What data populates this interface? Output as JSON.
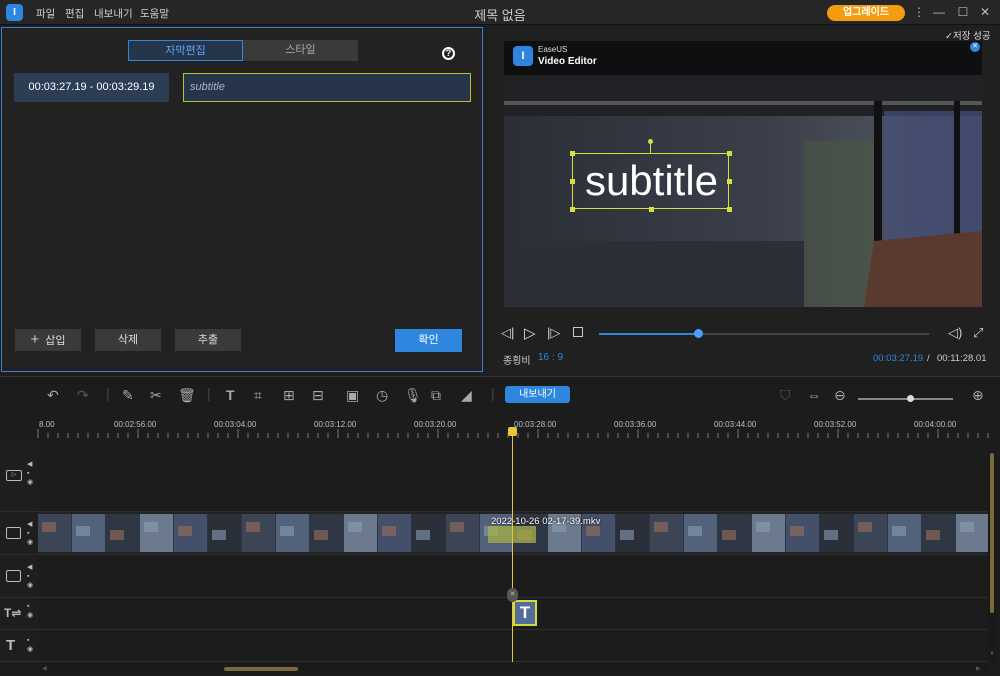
{
  "app": {
    "title": "제목 없음",
    "menu": [
      "파일",
      "편집",
      "내보내기",
      "도움말"
    ],
    "upgrade_label": "업그레이드",
    "logo_glyph": "I"
  },
  "subtitle_editor": {
    "tabs": [
      "자막편집",
      "스타일"
    ],
    "active_tab": "자막편집",
    "entry": {
      "time_range": "00:03:27.19 - 00:03:29.19",
      "text_placeholder": "subtitle"
    },
    "buttons": {
      "insert": "삽입",
      "delete": "삭제",
      "extract": "추출",
      "confirm": "확인"
    }
  },
  "preview": {
    "save_status": "저장 성공",
    "watermark_brand": "EaseUS",
    "watermark_product": "Video Editor",
    "overlay_text": "subtitle",
    "aspect_label": "종횡비",
    "aspect_value": "16 : 9",
    "current_time": "00:03:27.19",
    "separator": "/",
    "total_time": "00:11:28.01",
    "progress_fraction": 0.3
  },
  "toolbar": {
    "export_label": "내보내기",
    "zoom_fraction": 0.55
  },
  "timeline": {
    "ruler": [
      "8.00",
      "00:02:56.00",
      "00:03:04.00",
      "00:03:12.00",
      "00:03:20.00",
      "00:03:28.00",
      "00:03:36.00",
      "00:03:44.00",
      "00:03:52.00",
      "00:04:00.00"
    ],
    "clip_name": "2022-10-26 02-17-39.mkv",
    "text_clip_glyph": "T"
  },
  "colors": {
    "accent": "#2e86de",
    "upgrade": "#f39c12",
    "playhead": "#e6c73a",
    "selection": "#b5c234"
  }
}
